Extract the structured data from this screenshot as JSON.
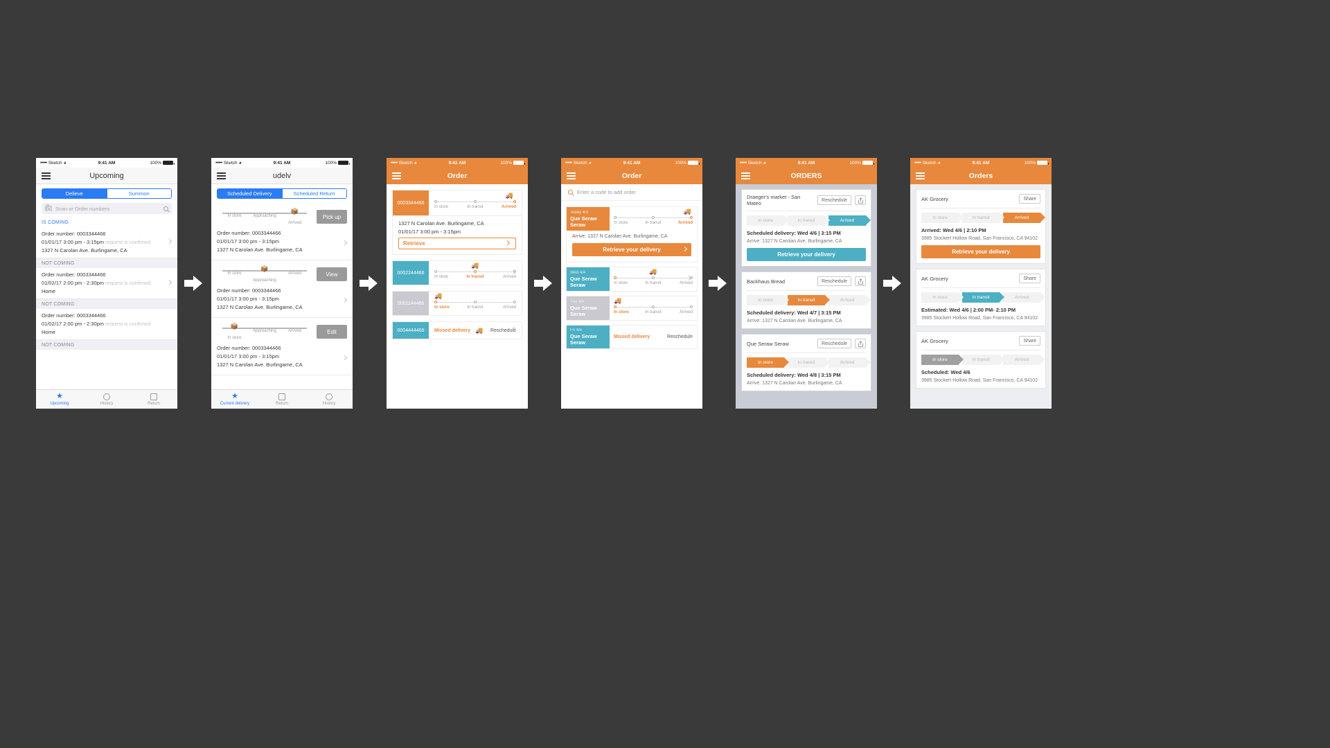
{
  "meta": {
    "background_color": "#3a3a3a",
    "status_bar": {
      "carrier": "Sketch",
      "dots": "•••••",
      "time": "9:41 AM",
      "battery": "100%",
      "wifi_icon": "wifi-icon"
    }
  },
  "colors": {
    "blue": "#2b7bf3",
    "orange": "#e8883c",
    "teal": "#4cafc4",
    "grey": "#b6b6bc",
    "muted": "#c3c3c3"
  },
  "screen1": {
    "title": "Upcoming",
    "menu_icon": "hamburger-icon",
    "segments": [
      {
        "label": "Delieve",
        "active": true
      },
      {
        "label": "Summon",
        "active": false
      }
    ],
    "search": {
      "placeholder": "Scan or Order numbers",
      "camera_icon": "camera-icon",
      "search_icon": "search-icon"
    },
    "sections": [
      {
        "header": "IS COMING",
        "header_style": "blue",
        "rows": [
          {
            "order_label": "Order number: 0003344466",
            "when": "01/01/17  3:00 pm - 3:15pm",
            "status_note": "request is confimed",
            "location": "1327 N Carolan Ave. Burlingame, CA"
          }
        ]
      },
      {
        "header": "NOT COMING",
        "header_style": "grey",
        "rows": [
          {
            "order_label": "Order number: 0003344466",
            "when": "01/02/17  2:00 pm - 2:30pm",
            "status_note": "request is confimed",
            "location": "Home"
          }
        ]
      },
      {
        "header": "NOT COMING",
        "header_style": "grey",
        "rows": [
          {
            "order_label": "Order number: 0003344466",
            "when": "01/02/17  2:00 pm - 2:30pm",
            "status_note": "request is confimed",
            "location": "Home"
          }
        ]
      },
      {
        "header": "NOT COMING",
        "header_style": "grey",
        "rows": []
      }
    ],
    "tabs": [
      {
        "label": "Upcoming",
        "icon": "star-icon",
        "active": true
      },
      {
        "label": "History",
        "icon": "circle-icon",
        "active": false
      },
      {
        "label": "Return",
        "icon": "square-icon",
        "active": false
      }
    ]
  },
  "screen2": {
    "title": "udelv",
    "menu_icon": "hamburger-icon",
    "segments": [
      {
        "label": "Scheduled Delivery",
        "active": true
      },
      {
        "label": "Scheduled Return",
        "active": false
      }
    ],
    "steps": [
      "In store",
      "Approaching",
      "Arrived"
    ],
    "cards": [
      {
        "active_step": 2,
        "button": "Pick up",
        "order_label": "Order number: 0003344466",
        "when": "01/01/17  3:00 pm - 3:15pm",
        "location": "1327 N Carolan Ave. Burlingame, CA"
      },
      {
        "active_step": 1,
        "button": "View",
        "order_label": "Order number: 0003344466",
        "when": "01/01/17  3:00 pm - 3:15pm",
        "location": "1327 N Carolan Ave. Burlingame, CA"
      },
      {
        "active_step": 0,
        "button": "Edit",
        "order_label": "Order number: 0003344466",
        "when": "01/01/17  3:00 pm - 3:15pm",
        "location": "1327 N Carolan Ave. Burlingame, CA"
      }
    ],
    "tabs": [
      {
        "label": "Current delivery",
        "icon": "star-icon",
        "active": true
      },
      {
        "label": "Return",
        "icon": "square-icon",
        "active": false
      },
      {
        "label": "History",
        "icon": "circle-icon",
        "active": false
      }
    ]
  },
  "screen3": {
    "title": "Order",
    "menu_icon": "hamburger-icon",
    "steps": [
      "In store",
      "In transit",
      "Arrived"
    ],
    "cards": [
      {
        "order_number": "0003344466",
        "tile_color": "#e8883c",
        "active_step": 2,
        "expanded": true,
        "location": "1327 N Carolan Ave. Burlingame, CA",
        "when": "01/01/17  3:00 pm - 3:15pm",
        "action": "Retrieve"
      },
      {
        "order_number": "0002244466",
        "tile_color": "#4cafc4",
        "active_step": 1,
        "expanded": false
      },
      {
        "order_number": "0001144466",
        "tile_color": "#c9c9cf",
        "active_step": 0,
        "expanded": false
      },
      {
        "order_number": "0004444466",
        "tile_color": "#4cafc4",
        "missed_label": "Missed delivery",
        "action": "Reschedule",
        "missed": true
      }
    ]
  },
  "screen4": {
    "title": "Order",
    "menu_icon": "hamburger-icon",
    "search": {
      "placeholder": "Enter a code to add order",
      "search_icon": "search-icon"
    },
    "steps": [
      "In store",
      "In transit",
      "Arrived"
    ],
    "cards": [
      {
        "date": "Today 4/3",
        "name": "Que Seraw Seraw",
        "tile_color": "#e8883c",
        "active_step": 2,
        "expanded": true,
        "info": "Arrive: 1327 N Carolan Ave. Burlingame, CA",
        "action": "Retrieve your delivery",
        "action_color": "#e8883c"
      },
      {
        "date": "Wed 4/4",
        "name": "Que Seraw Seraw",
        "tile_color": "#4cafc4",
        "active_step": 0,
        "expanded": false
      },
      {
        "date": "Thu 4/5",
        "name": "Que Seraw Seraw",
        "tile_color": "#c9c9cf",
        "active_step": 0,
        "expanded": false
      },
      {
        "date": "Fri 4/6",
        "name": "Que Seraw Seraw",
        "tile_color": "#4cafc4",
        "missed_label": "Missed delivery",
        "action": "Reschedule",
        "missed": true
      }
    ]
  },
  "screen5": {
    "title": "ORDERS",
    "menu_icon": "hamburger-icon",
    "steps": [
      "In store",
      "In transit",
      "Arrived"
    ],
    "cards": [
      {
        "name": "Draeger's market - San Mateo",
        "reschedule_label": "Reschedule",
        "share_icon": "share-icon",
        "active_step": 2,
        "active_color": "teal",
        "line1": "Scheduled delivery: Wed 4/6 | 3:15 PM",
        "line2": "Arrive: 1327 N Carolan Ave. Burlingame, CA",
        "button": "Retrieve your delivery",
        "button_color": "#4cafc4"
      },
      {
        "name": "Backhaus Bread",
        "reschedule_label": "Reschedule",
        "share_icon": "share-icon",
        "active_step": 1,
        "active_color": "orange",
        "line1": "Scheduled delivery: Wed 4/7 | 3:15 PM",
        "line2": "Arrive: 1327 N Carolan Ave. Burlingame, CA"
      },
      {
        "name": "Que Seraw Seraw",
        "reschedule_label": "Reschedule",
        "share_icon": "share-icon",
        "active_step": 0,
        "active_color": "orange",
        "line1": "Scheduled delivery: Wed 4/8 | 3:15 PM",
        "line2": "Arrive: 1327 N Carolan Ave. Burlingame, CA"
      }
    ]
  },
  "screen6": {
    "title": "Orders",
    "menu_icon": "hamburger-icon",
    "steps": [
      "In store",
      "In transit",
      "Arrived"
    ],
    "cards": [
      {
        "name": "AK Grocery",
        "share_label": "Share",
        "active_step": 2,
        "active_color": "orange",
        "line1": "Arrived: Wed 4/6  |  2:10 PM",
        "line2": "3985 Stockert Hollow Road, San Francisco, CA 94102",
        "button": "Retrieve your delivery",
        "button_color": "#e8883c"
      },
      {
        "name": "AK Grocery",
        "share_label": "Share",
        "active_step": 1,
        "active_color": "teal",
        "line1": "Estimated: Wed 4/6  |  2:00 PM- 2:10 PM",
        "line2": "3985 Stockert Hollow Road, San Francisco, CA 94102"
      },
      {
        "name": "AK Grocery",
        "share_label": "Share",
        "active_step": 0,
        "active_color": "grey",
        "line1": "Scheduled: Wed 4/6",
        "line2": "3985 Stockert Hollow Road, San Francisco, CA 94102"
      }
    ]
  },
  "arrows": {
    "count": 5,
    "icon": "right-arrow-icon",
    "color": "#ffffff"
  }
}
